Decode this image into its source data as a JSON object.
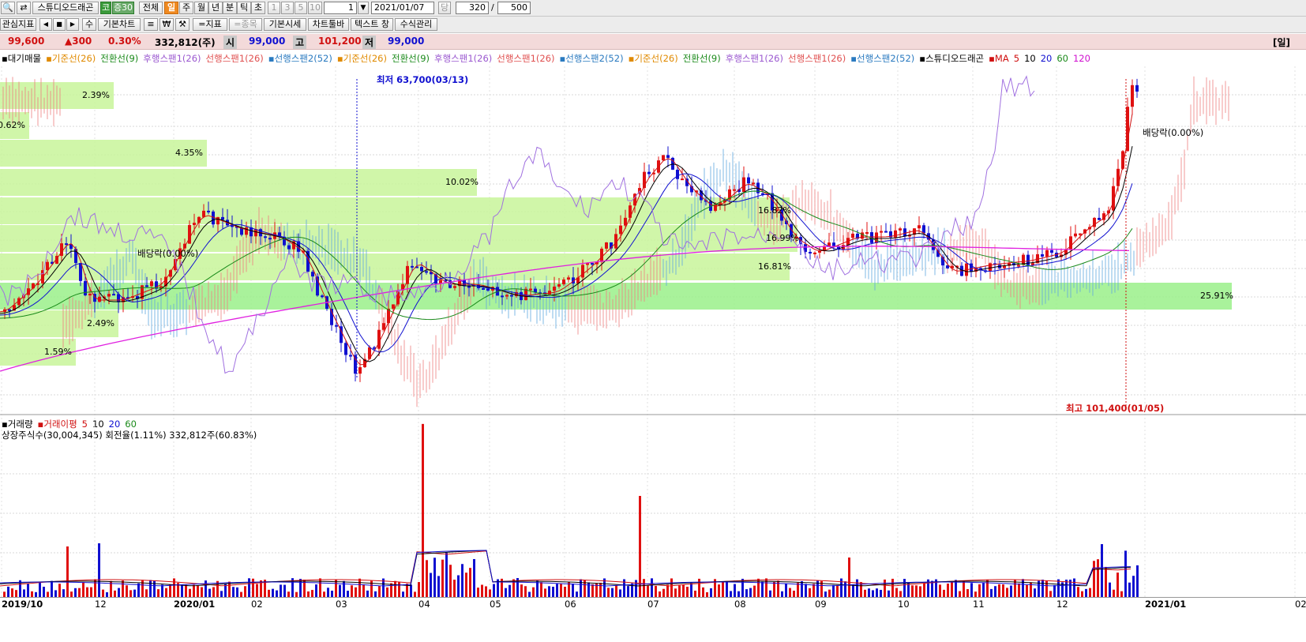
{
  "toolbar1": {
    "stock_name": "스튜디오드래곤",
    "market_badge": "코",
    "margin_badge": "증30",
    "period_all": "전체",
    "period_day": "일",
    "period_week": "주",
    "period_month": "월",
    "period_year": "년",
    "period_minute": "분",
    "period_tick": "틱",
    "period_second": "초",
    "n1": "1",
    "n3": "3",
    "n5": "5",
    "n10": "10",
    "interval_value": "1",
    "date_value": "2021/01/07",
    "dang_label": "당",
    "count_value": "320",
    "slash": "/",
    "total_value": "500"
  },
  "toolbar2": {
    "watch_indicator": "관심지표",
    "sum_label": "수",
    "basic_chart": "기본차트",
    "indicator_btn": "=지표",
    "item_btn": "=종목",
    "basic_quote": "기본시세",
    "chart_toolbar": "차트툴바",
    "text_window": "텍스트 창",
    "formula_mgmt": "수식관리"
  },
  "price_bar": {
    "price": "99,600",
    "change": "▲300",
    "change_pct": "0.30%",
    "volume": "332,812(주)",
    "open_label": "시",
    "open": "99,000",
    "high_label": "고",
    "high": "101,200",
    "low_label": "저",
    "low": "99,000",
    "period_tag": "[일]"
  },
  "legend": [
    {
      "text": "▪대기매물",
      "color": "#000000"
    },
    {
      "text": "▪기준선(26)",
      "color": "#e08a00"
    },
    {
      "text": "전환선(9)",
      "color": "#1a8a1a"
    },
    {
      "text": "후행스팬1(26)",
      "color": "#9b59d0"
    },
    {
      "text": "선행스팬1(26)",
      "color": "#e05050"
    },
    {
      "text": "▪선행스팬2(52)",
      "color": "#2a7ac0"
    },
    {
      "text": "▪기준선(26)",
      "color": "#e08a00"
    },
    {
      "text": "전환선(9)",
      "color": "#1a8a1a"
    },
    {
      "text": "후행스팬1(26)",
      "color": "#9b59d0"
    },
    {
      "text": "선행스팬1(26)",
      "color": "#e05050"
    },
    {
      "text": "▪선행스팬2(52)",
      "color": "#2a7ac0"
    },
    {
      "text": "▪기준선(26)",
      "color": "#e08a00"
    },
    {
      "text": "전환선(9)",
      "color": "#1a8a1a"
    },
    {
      "text": "후행스팬1(26)",
      "color": "#9b59d0"
    },
    {
      "text": "선행스팬1(26)",
      "color": "#e05050"
    },
    {
      "text": "▪선행스팬2(52)",
      "color": "#2a7ac0"
    },
    {
      "text": "▪스튜디오드래곤",
      "color": "#000000"
    },
    {
      "text": "▪MA",
      "color": "#d01010"
    },
    {
      "text": "5",
      "color": "#d01010"
    },
    {
      "text": "10",
      "color": "#000000"
    },
    {
      "text": "20",
      "color": "#1010d0"
    },
    {
      "text": "60",
      "color": "#1a8a1a"
    },
    {
      "text": "120",
      "color": "#d010d0"
    }
  ],
  "volume_legend": [
    {
      "text": "▪거래량",
      "color": "#000000"
    },
    {
      "text": "▪거래이평",
      "color": "#d01010"
    },
    {
      "text": "5",
      "color": "#d01010"
    },
    {
      "text": "10",
      "color": "#000000"
    },
    {
      "text": "20",
      "color": "#1010d0"
    },
    {
      "text": "60",
      "color": "#1a8a1a"
    }
  ],
  "volume_info": "상장주식수(30,004,345) 회전율(1.11%) 332,812주(60.83%)",
  "annotations": {
    "low_marker": "최저 63,700(03/13)",
    "high_marker": "최고 101,400(01/05)",
    "dividend1": "배당락(0.00%)",
    "dividend2": "배당락(0.00%)"
  },
  "volume_profile": [
    {
      "pct": "2.39%",
      "level": 121
    },
    {
      "pct": "0.62%",
      "level": 159
    },
    {
      "pct": "4.35%",
      "level": 194
    },
    {
      "pct": "10.02%",
      "level": 231
    },
    {
      "pct": "16.82%",
      "level": 267
    },
    {
      "pct": "16.99%",
      "level": 302
    },
    {
      "pct": "16.81%",
      "level": 338
    },
    {
      "pct": "25.91%",
      "level": 375
    },
    {
      "pct": "2.49%",
      "level": 410
    },
    {
      "pct": "1.59%",
      "level": 446
    }
  ],
  "x_labels": [
    {
      "text": "2019/10",
      "bold": true
    },
    {
      "text": "12",
      "bold": false
    },
    {
      "text": "2020/01",
      "bold": true
    },
    {
      "text": "02",
      "bold": false
    },
    {
      "text": "03",
      "bold": false
    },
    {
      "text": "04",
      "bold": false
    },
    {
      "text": "05",
      "bold": false
    },
    {
      "text": "06",
      "bold": false
    },
    {
      "text": "07",
      "bold": false
    },
    {
      "text": "08",
      "bold": false
    },
    {
      "text": "09",
      "bold": false
    },
    {
      "text": "10",
      "bold": false
    },
    {
      "text": "11",
      "bold": false
    },
    {
      "text": "12",
      "bold": false
    },
    {
      "text": "2021/01",
      "bold": true
    },
    {
      "text": "02",
      "bold": false
    }
  ],
  "colors": {
    "up": "#e01010",
    "down": "#1010d0",
    "profile": "#c8f59a",
    "profile_max": "#9af08a",
    "ma120": "#e020e0",
    "ichimoku_red": "#f08080",
    "ichimoku_blue": "#60a8e0"
  }
}
